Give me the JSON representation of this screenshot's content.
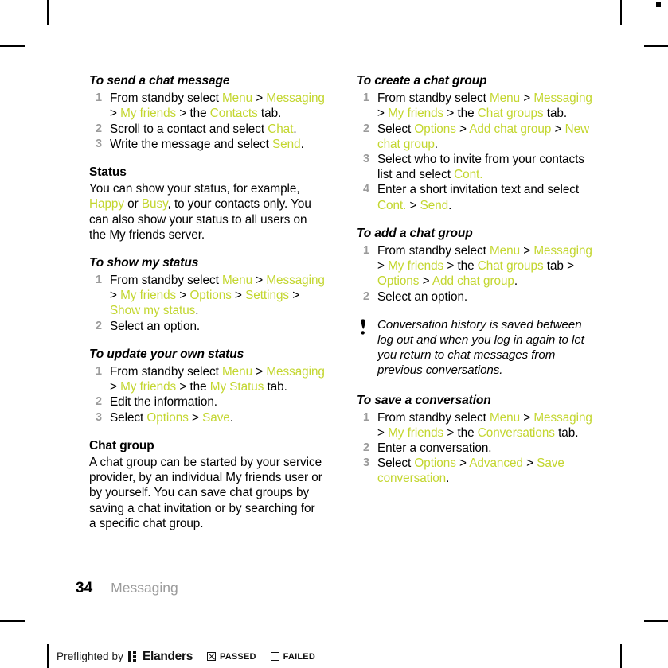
{
  "document": {
    "page_number": "34",
    "chapter": "Messaging",
    "accent_color": "#c3d62f",
    "step_number_color": "#9b9b9b"
  },
  "left_column": {
    "sections": [
      {
        "heading": "To send a chat message",
        "heading_style": "italic",
        "steps": [
          [
            {
              "t": "From standby select ",
              "c": "black"
            },
            {
              "t": "Menu",
              "c": "green"
            },
            {
              "t": " > ",
              "c": "black"
            },
            {
              "t": "Messaging",
              "c": "green"
            },
            {
              "t": " > ",
              "c": "black"
            },
            {
              "t": "My friends",
              "c": "green"
            },
            {
              "t": " > the ",
              "c": "black"
            },
            {
              "t": "Contacts",
              "c": "green"
            },
            {
              "t": " tab.",
              "c": "black"
            }
          ],
          [
            {
              "t": "Scroll to a contact and select ",
              "c": "black"
            },
            {
              "t": "Chat",
              "c": "green"
            },
            {
              "t": ".",
              "c": "black"
            }
          ],
          [
            {
              "t": "Write the message and select ",
              "c": "black"
            },
            {
              "t": "Send",
              "c": "green"
            },
            {
              "t": ".",
              "c": "black"
            }
          ]
        ]
      },
      {
        "heading": "Status",
        "heading_style": "plain",
        "paragraph": [
          {
            "t": "You can show your status, for example, ",
            "c": "black"
          },
          {
            "t": "Happy",
            "c": "green"
          },
          {
            "t": " or ",
            "c": "black"
          },
          {
            "t": "Busy",
            "c": "green"
          },
          {
            "t": ", to your contacts only. You can also show your status to all users on the My friends server.",
            "c": "black"
          }
        ]
      },
      {
        "heading": "To show my status",
        "heading_style": "italic",
        "steps": [
          [
            {
              "t": "From standby select ",
              "c": "black"
            },
            {
              "t": "Menu",
              "c": "green"
            },
            {
              "t": " > ",
              "c": "black"
            },
            {
              "t": "Messaging",
              "c": "green"
            },
            {
              "t": " > ",
              "c": "black"
            },
            {
              "t": "My friends",
              "c": "green"
            },
            {
              "t": " > ",
              "c": "black"
            },
            {
              "t": "Options",
              "c": "green"
            },
            {
              "t": " > ",
              "c": "black"
            },
            {
              "t": "Settings",
              "c": "green"
            },
            {
              "t": " > ",
              "c": "black"
            },
            {
              "t": "Show my status",
              "c": "green"
            },
            {
              "t": ".",
              "c": "black"
            }
          ],
          [
            {
              "t": "Select an option.",
              "c": "black"
            }
          ]
        ]
      },
      {
        "heading": "To update your own status",
        "heading_style": "italic",
        "steps": [
          [
            {
              "t": "From standby select ",
              "c": "black"
            },
            {
              "t": "Menu",
              "c": "green"
            },
            {
              "t": " > ",
              "c": "black"
            },
            {
              "t": "Messaging",
              "c": "green"
            },
            {
              "t": " > ",
              "c": "black"
            },
            {
              "t": "My friends",
              "c": "green"
            },
            {
              "t": " > the ",
              "c": "black"
            },
            {
              "t": "My Status",
              "c": "green"
            },
            {
              "t": " tab.",
              "c": "black"
            }
          ],
          [
            {
              "t": "Edit the information.",
              "c": "black"
            }
          ],
          [
            {
              "t": "Select ",
              "c": "black"
            },
            {
              "t": "Options",
              "c": "green"
            },
            {
              "t": " > ",
              "c": "black"
            },
            {
              "t": "Save",
              "c": "green"
            },
            {
              "t": ".",
              "c": "black"
            }
          ]
        ]
      },
      {
        "heading": "Chat group",
        "heading_style": "plain",
        "paragraph": [
          {
            "t": "A chat group can be started by your service provider, by an individual My friends user or by yourself. You can save chat groups by saving a chat invitation or by searching for a specific chat group.",
            "c": "black"
          }
        ]
      }
    ]
  },
  "right_column": {
    "sections": [
      {
        "heading": "To create a chat group",
        "heading_style": "italic",
        "steps": [
          [
            {
              "t": "From standby select ",
              "c": "black"
            },
            {
              "t": "Menu",
              "c": "green"
            },
            {
              "t": " > ",
              "c": "black"
            },
            {
              "t": "Messaging",
              "c": "green"
            },
            {
              "t": " > ",
              "c": "black"
            },
            {
              "t": "My friends",
              "c": "green"
            },
            {
              "t": " > the ",
              "c": "black"
            },
            {
              "t": "Chat groups",
              "c": "green"
            },
            {
              "t": " tab.",
              "c": "black"
            }
          ],
          [
            {
              "t": "Select ",
              "c": "black"
            },
            {
              "t": "Options",
              "c": "green"
            },
            {
              "t": " > ",
              "c": "black"
            },
            {
              "t": "Add chat group",
              "c": "green"
            },
            {
              "t": " > ",
              "c": "black"
            },
            {
              "t": "New chat group",
              "c": "green"
            },
            {
              "t": ".",
              "c": "black"
            }
          ],
          [
            {
              "t": "Select who to invite from your contacts list and select ",
              "c": "black"
            },
            {
              "t": "Cont.",
              "c": "green"
            }
          ],
          [
            {
              "t": "Enter a short invitation text and select ",
              "c": "black"
            },
            {
              "t": "Cont.",
              "c": "green"
            },
            {
              "t": " > ",
              "c": "black"
            },
            {
              "t": "Send",
              "c": "green"
            },
            {
              "t": ".",
              "c": "black"
            }
          ]
        ]
      },
      {
        "heading": "To add a chat group",
        "heading_style": "italic",
        "steps": [
          [
            {
              "t": "From standby select ",
              "c": "black"
            },
            {
              "t": "Menu",
              "c": "green"
            },
            {
              "t": " > ",
              "c": "black"
            },
            {
              "t": "Messaging",
              "c": "green"
            },
            {
              "t": " > ",
              "c": "black"
            },
            {
              "t": "My friends",
              "c": "green"
            },
            {
              "t": " > the ",
              "c": "black"
            },
            {
              "t": "Chat groups",
              "c": "green"
            },
            {
              "t": " tab > ",
              "c": "black"
            },
            {
              "t": "Options",
              "c": "green"
            },
            {
              "t": " > ",
              "c": "black"
            },
            {
              "t": "Add chat group",
              "c": "green"
            },
            {
              "t": ".",
              "c": "black"
            }
          ],
          [
            {
              "t": "Select an option.",
              "c": "black"
            }
          ]
        ]
      }
    ],
    "note": {
      "icon": "exclamation-note-icon",
      "text": "Conversation history is saved between log out and when you log in again to let you return to chat messages from previous conversations."
    },
    "sections_after_note": [
      {
        "heading": "To save a conversation",
        "heading_style": "italic",
        "steps": [
          [
            {
              "t": "From standby select ",
              "c": "black"
            },
            {
              "t": "Menu",
              "c": "green"
            },
            {
              "t": " > ",
              "c": "black"
            },
            {
              "t": "Messaging",
              "c": "green"
            },
            {
              "t": " > ",
              "c": "black"
            },
            {
              "t": "My friends",
              "c": "green"
            },
            {
              "t": " > the ",
              "c": "black"
            },
            {
              "t": "Conversations",
              "c": "green"
            },
            {
              "t": " tab.",
              "c": "black"
            }
          ],
          [
            {
              "t": "Enter a conversation.",
              "c": "black"
            }
          ],
          [
            {
              "t": "Select ",
              "c": "black"
            },
            {
              "t": "Options",
              "c": "green"
            },
            {
              "t": " > ",
              "c": "black"
            },
            {
              "t": "Advanced",
              "c": "green"
            },
            {
              "t": " > ",
              "c": "black"
            },
            {
              "t": "Save conversation",
              "c": "green"
            },
            {
              "t": ".",
              "c": "black"
            }
          ]
        ]
      }
    ]
  },
  "preflight_bar": {
    "prefix_text": "Preflighted by",
    "brand": "Elanders",
    "passed_label": "PASSED",
    "passed_checked": true,
    "failed_label": "FAILED",
    "failed_checked": false
  }
}
